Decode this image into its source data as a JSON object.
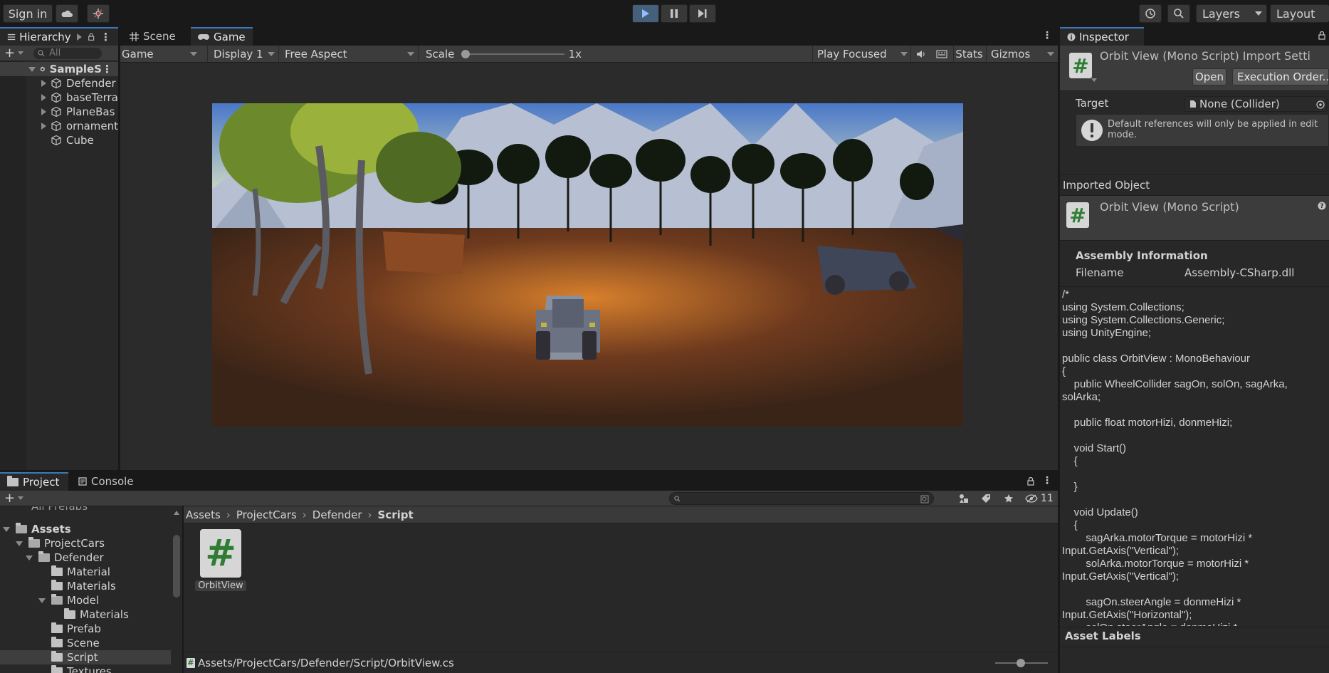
{
  "toolbar": {
    "sign_in": "Sign in",
    "layers": "Layers",
    "layout": "Layout"
  },
  "hierarchy": {
    "tab": "Hierarchy",
    "search_placeholder": "All",
    "scene": "SampleS",
    "items": [
      "Defender",
      "baseTerra",
      "PlaneBas",
      "ornament",
      "Cube"
    ]
  },
  "view_tabs": {
    "scene": "Scene",
    "game": "Game"
  },
  "game_bar": {
    "mode": "Game",
    "display": "Display 1",
    "aspect": "Free Aspect",
    "scale_label": "Scale",
    "scale_value": "1x",
    "play_focused": "Play Focused",
    "stats": "Stats",
    "gizmos": "Gizmos"
  },
  "inspector": {
    "tab": "Inspector",
    "title": "Orbit View (Mono Script) Import Setti",
    "open": "Open",
    "execution_order": "Execution Order...",
    "target_label": "Target",
    "target_value": "None (Collider)",
    "warning": "Default references will only be applied in edit mode.",
    "imported_object": "Imported Object",
    "object_name": "Orbit View (Mono Script)",
    "assembly_info": "Assembly Information",
    "filename_label": "Filename",
    "filename_value": "Assembly-CSharp.dll",
    "code": "/*\nusing System.Collections;\nusing System.Collections.Generic;\nusing UnityEngine;\n\npublic class OrbitView : MonoBehaviour\n{\n    public WheelCollider sagOn, solOn, sagArka, solArka;\n\n    public float motorHizi, donmeHizi;\n\n    void Start()\n    {\n\n    }\n\n    void Update()\n    {\n        sagArka.motorTorque = motorHizi * Input.GetAxis(\"Vertical\");\n        solArka.motorTorque = motorHizi * Input.GetAxis(\"Vertical\");\n\n        sagOn.steerAngle = donmeHizi * Input.GetAxis(\"Horizontal\");\n        solOn.steerAngle = donmeHizi * Input.GetAxis(\"Horizontal\");",
    "asset_labels": "Asset Labels"
  },
  "project": {
    "tab_project": "Project",
    "tab_console": "Console",
    "hidden_count": "11",
    "breadcrumb": [
      "Assets",
      "ProjectCars",
      "Defender",
      "Script"
    ],
    "tree": [
      {
        "label": "All Prefabs",
        "depth": 1
      },
      {
        "label": "Assets",
        "depth": 0
      },
      {
        "label": "ProjectCars",
        "depth": 1
      },
      {
        "label": "Defender",
        "depth": 2
      },
      {
        "label": "Material",
        "depth": 3
      },
      {
        "label": "Materials",
        "depth": 3
      },
      {
        "label": "Model",
        "depth": 3
      },
      {
        "label": "Materials",
        "depth": 4
      },
      {
        "label": "Prefab",
        "depth": 3
      },
      {
        "label": "Scene",
        "depth": 3
      },
      {
        "label": "Script",
        "depth": 3
      },
      {
        "label": "Textures",
        "depth": 3
      }
    ],
    "asset_name": "OrbitView",
    "asset_glyph": "#",
    "status_path": "Assets/ProjectCars/Defender/Script/OrbitView.cs"
  },
  "colors": {
    "accent": "#3a79bb",
    "play_active": "#46607c",
    "panel": "#282828",
    "script_green": "#2e7d32"
  }
}
